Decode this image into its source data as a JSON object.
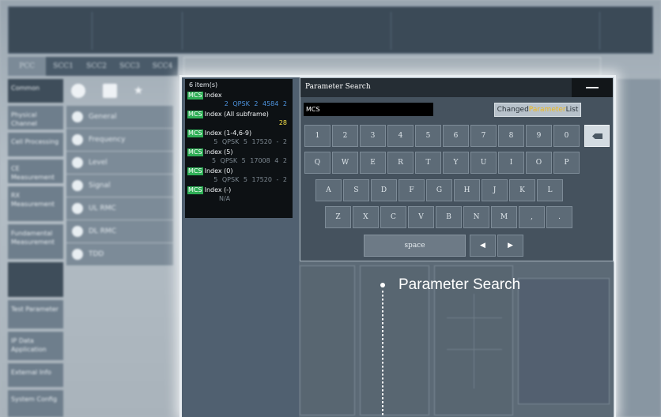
{
  "results": {
    "count_label": "6 item(s)",
    "items": [
      {
        "badge": "MCS",
        "name": "Index",
        "values": "2  QPSK  2  4584  2",
        "color": "blue"
      },
      {
        "badge": "MCS",
        "name": "Index (All subframe)",
        "values": "28",
        "color": "yellow"
      },
      {
        "badge": "MCS",
        "name": "Index (1-4,6-9)",
        "values": "5  QPSK  5  17520  -  2",
        "color": "grey"
      },
      {
        "badge": "MCS",
        "name": "Index (5)",
        "values": "5  QPSK  5  17008  4  2",
        "color": "grey"
      },
      {
        "badge": "MCS",
        "name": "Index (0)",
        "values": "5  QPSK  5  17520  -  2",
        "color": "grey"
      },
      {
        "badge": "MCS",
        "name": "Index (-)",
        "values": "N/A",
        "color": "grey"
      }
    ]
  },
  "dialog": {
    "title": "Parameter Search",
    "search_value": "MCS",
    "changed_list": {
      "prefix": "Changed",
      "highlight": "Parameter",
      "suffix": "List"
    },
    "space_label": "space",
    "left_arrow": "◀",
    "right_arrow": "▶"
  },
  "keyboard": {
    "row1": [
      "1",
      "2",
      "3",
      "4",
      "5",
      "6",
      "7",
      "8",
      "9",
      "0"
    ],
    "row2": [
      "Q",
      "W",
      "E",
      "R",
      "T",
      "Y",
      "U",
      "I",
      "O",
      "P"
    ],
    "row3": [
      "A",
      "S",
      "D",
      "F",
      "G",
      "H",
      "J",
      "K",
      "L"
    ],
    "row4": [
      "Z",
      "X",
      "C",
      "V",
      "B",
      "N",
      "M",
      ",",
      "."
    ]
  },
  "callout": {
    "label": "Parameter Search"
  },
  "background": {
    "tabs": [
      "PCC",
      "SCC1",
      "SCC2",
      "SCC3",
      "SCC4"
    ],
    "nav_items": [
      "Common",
      "Physical Channel",
      "Cell Processing",
      "CE Measurement",
      "RX Measurement",
      "Fundamental Measurement",
      "Test Parameter",
      "IP Data Application",
      "External Info",
      "System Config"
    ],
    "menu_items": [
      "General",
      "Frequency",
      "Level",
      "Signal",
      "UL RMC",
      "DL RMC",
      "TDD"
    ]
  },
  "colors": {
    "accent_green": "#2fae56",
    "highlight_yellow": "#f0b91a",
    "value_blue": "#4e94df",
    "value_yellow": "#f5e04a"
  }
}
